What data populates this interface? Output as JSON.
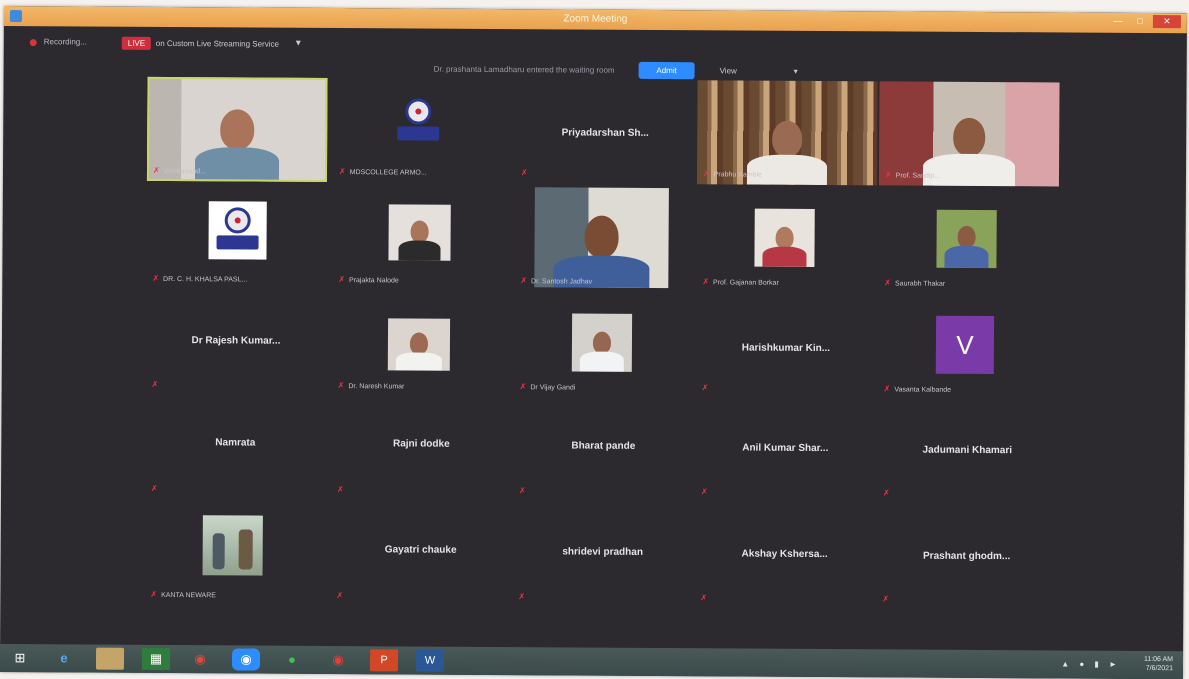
{
  "window": {
    "title": "Zoom Meeting"
  },
  "recording": {
    "label": "Recording...",
    "live_badge": "LIVE",
    "live_text": "on Custom Live Streaming Service"
  },
  "waiting_room": {
    "notice": "Dr. prashanta Lamadharu entered the waiting room",
    "admit_label": "Admit",
    "view_label": "View"
  },
  "participants": [
    {
      "name": "Vivekanand...",
      "type": "video"
    },
    {
      "name": "MDSCOLLEGE ARMO...",
      "type": "logo"
    },
    {
      "name": "Priyadarshan Sh...",
      "type": "name"
    },
    {
      "name": "Prabhu Kamble",
      "type": "video"
    },
    {
      "name": "Prof. Sandip...",
      "type": "video"
    },
    {
      "name": "DR. C. H. KHALSA PASL...",
      "type": "logo"
    },
    {
      "name": "Prajakta Nalode",
      "type": "video"
    },
    {
      "name": "Dr. Santosh Jadhav",
      "type": "video"
    },
    {
      "name": "Prof. Gajanan Borkar",
      "type": "video"
    },
    {
      "name": "Saurabh Thakar",
      "type": "video"
    },
    {
      "name": "Dr Rajesh Kumar...",
      "type": "name"
    },
    {
      "name": "Dr. Naresh Kumar",
      "type": "video"
    },
    {
      "name": "Dr Vijay Gandi",
      "type": "video"
    },
    {
      "name": "Harishkumar Kin...",
      "type": "name"
    },
    {
      "name": "Vasanta Kalbande",
      "type": "avatar",
      "initial": "V"
    },
    {
      "name": "Namrata",
      "type": "name"
    },
    {
      "name": "Rajni dodke",
      "type": "name"
    },
    {
      "name": "Bharat pande",
      "type": "name"
    },
    {
      "name": "Anil Kumar Shar...",
      "type": "name"
    },
    {
      "name": "Jadumani Khamari",
      "type": "name"
    },
    {
      "name": "KANTA NEWARE",
      "type": "photo"
    },
    {
      "name": "Gayatri chauke",
      "type": "name"
    },
    {
      "name": "shridevi pradhan",
      "type": "name"
    },
    {
      "name": "Akshay Kshersa...",
      "type": "name"
    },
    {
      "name": "Prashant ghodm...",
      "type": "name"
    }
  ],
  "taskbar": {
    "time": "11:06 AM",
    "date": "7/6/2021"
  },
  "colors": {
    "meeting_bg": "#2c2a2e",
    "admit_blue": "#2d8cff",
    "live_red": "#cf2f3d",
    "active_speaker": "#c9d46a",
    "avatar_purple": "#7a3aa8"
  }
}
